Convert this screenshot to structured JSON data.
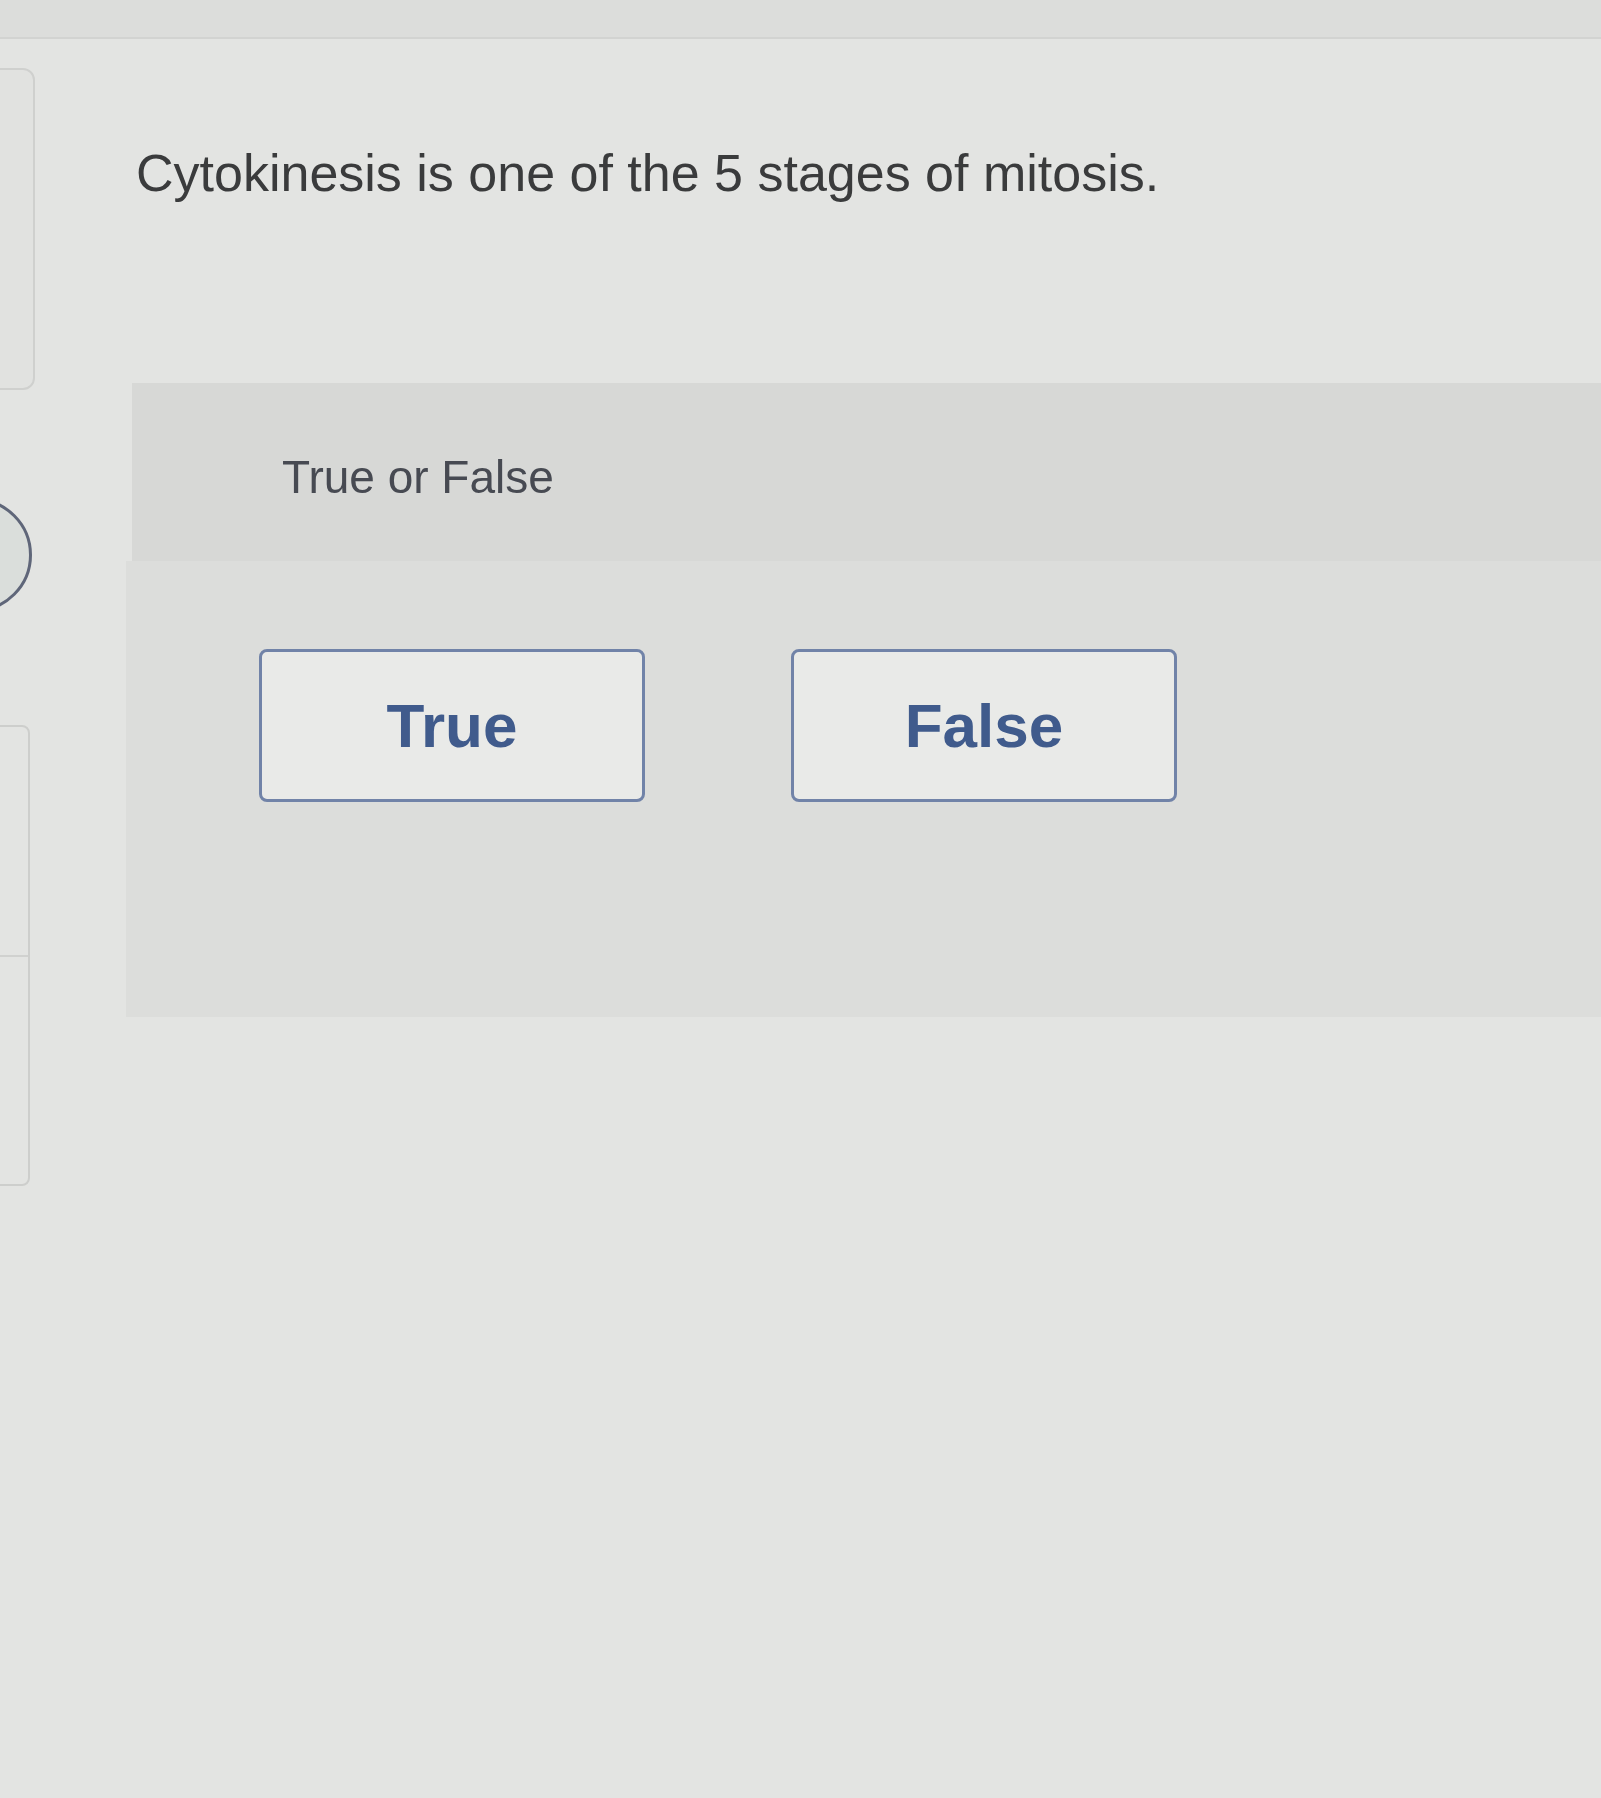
{
  "question": {
    "text": "Cytokinesis is one of the 5 stages of mitosis."
  },
  "answer_panel": {
    "prompt": "True or False",
    "choices": [
      {
        "label": "True",
        "selected": false
      },
      {
        "label": "False",
        "selected": false
      }
    ]
  }
}
